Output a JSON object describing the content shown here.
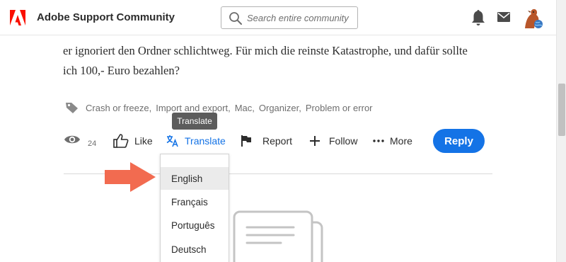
{
  "header": {
    "brand": "Adobe Support Community",
    "search_placeholder": "Search entire community",
    "brand_color": "#fa0f00"
  },
  "post": {
    "line1": "er ignoriert den Ordner schlichtweg. Für mich die reinste Katastrophe, und dafür sollte",
    "line2": "ich 100,- Euro bezahlen?"
  },
  "tags": [
    "Crash or freeze,",
    "Import and export,",
    "Mac,",
    "Organizer,",
    "Problem or error"
  ],
  "actions": {
    "views": "24",
    "like": "Like",
    "translate": "Translate",
    "report": "Report",
    "follow": "Follow",
    "more": "More",
    "reply": "Reply",
    "tooltip": "Translate",
    "accent": "#1473e6"
  },
  "translate_menu": {
    "options": [
      "English",
      "Français",
      "Português",
      "Deutsch"
    ],
    "selected": "English"
  },
  "annotation": {
    "arrow_color": "#f26b50"
  }
}
